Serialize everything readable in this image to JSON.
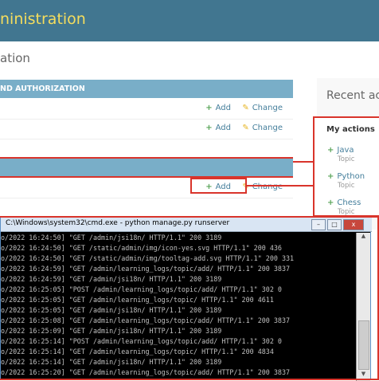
{
  "header": {
    "title": "ninistration"
  },
  "site": {
    "title": "ation"
  },
  "module1": {
    "caption": "ND AUTHORIZATION",
    "rows": [
      {
        "add": "Add",
        "change": "Change"
      },
      {
        "add": "Add",
        "change": "Change"
      }
    ]
  },
  "module2": {
    "rows": [
      {
        "add": "Add",
        "change": "Change"
      }
    ]
  },
  "recent": {
    "title": "Recent act",
    "my_actions": "My actions",
    "items": [
      {
        "name": "Java",
        "type": "Topic"
      },
      {
        "name": "Python",
        "type": "Topic"
      },
      {
        "name": "Chess",
        "type": "Topic"
      }
    ]
  },
  "cmd": {
    "title": "C:\\Windows\\system32\\cmd.exe - python  manage.py runserver",
    "buttons": {
      "minimize": "–",
      "maximize": "□",
      "close": "x"
    },
    "lines": [
      "o/2022 16:24:50] \"GET /admin/jsi18n/ HTTP/1.1\" 200 3189",
      "o/2022 16:24:50] \"GET /static/admin/img/icon-yes.svg HTTP/1.1\" 200 436",
      "o/2022 16:24:50] \"GET /static/admin/img/tooltag-add.svg HTTP/1.1\" 200 331",
      "o/2022 16:24:59] \"GET /admin/learning_logs/topic/add/ HTTP/1.1\" 200 3837",
      "o/2022 16:24:59] \"GET /admin/jsi18n/ HTTP/1.1\" 200 3189",
      "o/2022 16:25:05] \"POST /admin/learning_logs/topic/add/ HTTP/1.1\" 302 0",
      "o/2022 16:25:05] \"GET /admin/learning_logs/topic/ HTTP/1.1\" 200 4611",
      "o/2022 16:25:05] \"GET /admin/jsi18n/ HTTP/1.1\" 200 3189",
      "o/2022 16:25:08] \"GET /admin/learning_logs/topic/add/ HTTP/1.1\" 200 3837",
      "o/2022 16:25:09] \"GET /admin/jsi18n/ HTTP/1.1\" 200 3189",
      "o/2022 16:25:14] \"POST /admin/learning_logs/topic/add/ HTTP/1.1\" 302 0",
      "o/2022 16:25:14] \"GET /admin/learning_logs/topic/ HTTP/1.1\" 200 4834",
      "o/2022 16:25:14] \"GET /admin/jsi18n/ HTTP/1.1\" 200 3189",
      "o/2022 16:25:20] \"GET /admin/learning_logs/topic/add/ HTTP/1.1\" 200 3837"
    ]
  }
}
